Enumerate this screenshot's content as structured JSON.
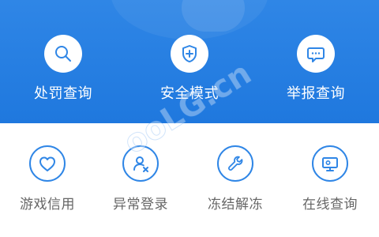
{
  "colors": {
    "primary": "#1f78de",
    "primary_light": "#2f86e6",
    "text_white": "#ffffff",
    "text_gray": "#666666",
    "white": "#ffffff"
  },
  "top_actions": [
    {
      "label": "处罚查询",
      "icon": "search-icon"
    },
    {
      "label": "安全模式",
      "icon": "shield-plus-icon"
    },
    {
      "label": "举报查询",
      "icon": "message-icon"
    }
  ],
  "bottom_actions": [
    {
      "label": "游戏信用",
      "icon": "heart-icon"
    },
    {
      "label": "异常登录",
      "icon": "user-x-icon"
    },
    {
      "label": "冻结解冻",
      "icon": "wrench-icon"
    },
    {
      "label": "在线查询",
      "icon": "monitor-icon"
    }
  ],
  "watermark": {
    "text": "ooLG.cn"
  }
}
